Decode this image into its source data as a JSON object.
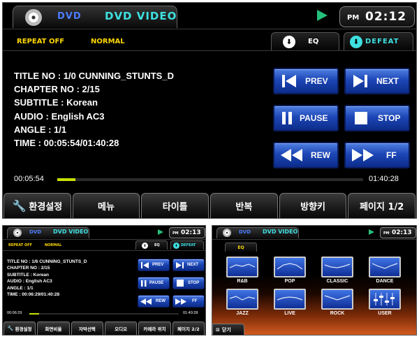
{
  "main": {
    "source": "DVD",
    "title": "DVD VIDEO",
    "clock": {
      "ampm": "PM",
      "time": "02:12"
    },
    "repeat": "REPEAT OFF",
    "mode": "NORMAL",
    "eq_label": "EQ",
    "eq_preset": "DEFEAT",
    "info": {
      "title_no": "TITLE NO : 1/0 CUNNING_STUNTS_D",
      "chapter_no": "CHAPTER NO : 2/15",
      "subtitle": "SUBTITLE : Korean",
      "audio": "AUDIO : English AC3",
      "angle": "ANGLE : 1/1",
      "time": "TIME : 00:05:54/01:40:28"
    },
    "buttons": {
      "prev": "PREV",
      "next": "NEXT",
      "pause": "PAUSE",
      "stop": "STOP",
      "rew": "REW",
      "ff": "FF"
    },
    "elapsed": "00:05:54",
    "total": "01:40:28",
    "progress": 0.059,
    "menu": [
      "환경설정",
      "메뉴",
      "타이틀",
      "반복",
      "방향키",
      "페이지 1/2"
    ]
  },
  "small": {
    "source": "DVD",
    "title": "DVD VIDEO",
    "clock": {
      "ampm": "PM",
      "time": "02:13"
    },
    "repeat": "REPEAT OFF",
    "mode": "NORMAL",
    "eq_label": "EQ",
    "eq_preset": "DEFEAT",
    "info": {
      "title_no": "TITLE NO : 1/6 CUNNING_STUNTS_D",
      "chapter_no": "CHAPTER NO : 2/15",
      "subtitle": "SUBTITLE : Korean",
      "audio": "AUDIO : English AC3",
      "angle": "ANGLE : 1/1",
      "time": "TIME : 00:06:29/01:40:28"
    },
    "buttons": {
      "prev": "PREV",
      "next": "NEXT",
      "pause": "PAUSE",
      "stop": "STOP",
      "rew": "REW",
      "ff": "FF"
    },
    "elapsed": "00:06:29",
    "total": "01:40:28",
    "progress": 0.065,
    "menu": [
      "환경설정",
      "화면비율",
      "자막선택",
      "오디오",
      "카메라 위치",
      "페이지 2/2"
    ]
  },
  "eq": {
    "source": "DVD",
    "title": "DVD VIDEO",
    "clock": {
      "ampm": "PM",
      "time": "02:13"
    },
    "tab": "EQ",
    "presets": [
      "R&B",
      "POP",
      "CLASSIC",
      "DANCE",
      "JAZZ",
      "LIVE",
      "ROCK",
      "USER"
    ],
    "close": "닫기",
    "accent": "#d25a1e"
  },
  "colors": {
    "blue_btn": "#1d46b6",
    "progress": "#c8e000",
    "yellow": "#ffd800",
    "cyan": "#3ee0e0",
    "play": "#23c17a"
  }
}
